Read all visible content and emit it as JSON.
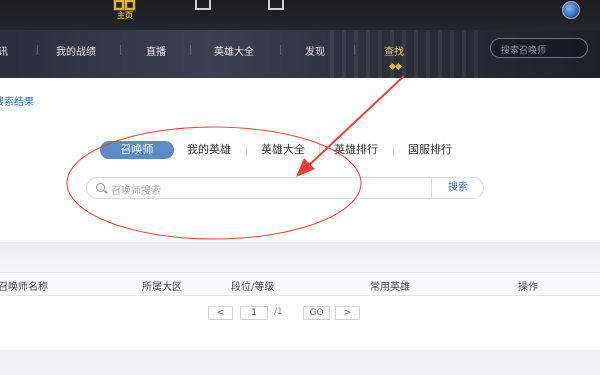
{
  "topbar": {
    "home_label": "主页",
    "icons": [
      "home-icon",
      "document-icon",
      "edit-icon",
      "avatar"
    ]
  },
  "nav": {
    "items": [
      {
        "label": "讯"
      },
      {
        "label": "我的战绩"
      },
      {
        "label": "直播"
      },
      {
        "label": "英雄大全"
      },
      {
        "label": "发现"
      },
      {
        "label": "查找"
      }
    ],
    "active_index": 5,
    "search_placeholder": "搜索召唤师"
  },
  "content": {
    "result_link": "搜索结果",
    "tabs": [
      {
        "label": "召唤师"
      },
      {
        "label": "我的英雄"
      },
      {
        "label": "英雄大全"
      },
      {
        "label": "英雄排行"
      },
      {
        "label": "国服排行"
      }
    ],
    "active_tab": 0,
    "search": {
      "placeholder": "召唤师搜索",
      "button_label": "搜索"
    }
  },
  "table": {
    "columns": [
      "召唤师名称",
      "所属大区",
      "段位/等级",
      "常用英雄",
      "操作"
    ]
  },
  "pager": {
    "prev": "<",
    "current": "1",
    "total": "/1",
    "go": "GO",
    "next": ">"
  },
  "colors": {
    "accent_gold": "#e0b23a",
    "tab_active": "#5a8dc8",
    "link_blue": "#3a6fb6",
    "annotation_red": "#e8413a"
  }
}
